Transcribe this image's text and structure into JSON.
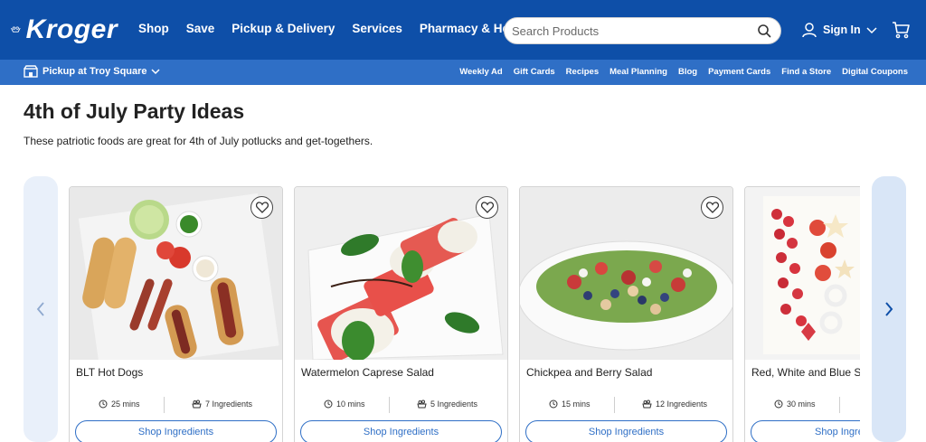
{
  "header": {
    "logo_text": "Kroger",
    "nav": [
      "Shop",
      "Save",
      "Pickup & Delivery",
      "Services",
      "Pharmacy & Health"
    ],
    "search_placeholder": "Search Products",
    "sign_in": "Sign In"
  },
  "subnav": {
    "pickup": "Pickup at Troy Square",
    "links": [
      "Weekly Ad",
      "Gift Cards",
      "Recipes",
      "Meal Planning",
      "Blog",
      "Payment Cards",
      "Find a Store",
      "Digital Coupons"
    ]
  },
  "page": {
    "title": "4th of July Party Ideas",
    "subtitle": "These patriotic foods are great for 4th of July potlucks and get-togethers."
  },
  "cards": [
    {
      "name": "BLT Hot Dogs",
      "time": "25 mins",
      "ingredients": "7 Ingredients",
      "button": "Shop Ingredients"
    },
    {
      "name": "Watermelon Caprese Salad",
      "time": "10 mins",
      "ingredients": "5 Ingredients",
      "button": "Shop Ingredients"
    },
    {
      "name": "Chickpea and Berry Salad",
      "time": "15 mins",
      "ingredients": "12 Ingredients",
      "button": "Shop Ingredients"
    },
    {
      "name": "Red, White and Blue S",
      "time": "30 mins",
      "ingredients": "",
      "button": "Shop Ingre"
    }
  ],
  "colors": {
    "brand_blue": "#0e4fa8",
    "subnav_blue": "#2f6fc6"
  },
  "icons": [
    "kroger-logo-icon",
    "search-icon",
    "user-icon",
    "chevron-down-icon",
    "cart-icon",
    "store-icon",
    "chevron-left-icon",
    "chevron-right-icon",
    "heart-icon",
    "clock-icon",
    "ingredients-icon"
  ]
}
